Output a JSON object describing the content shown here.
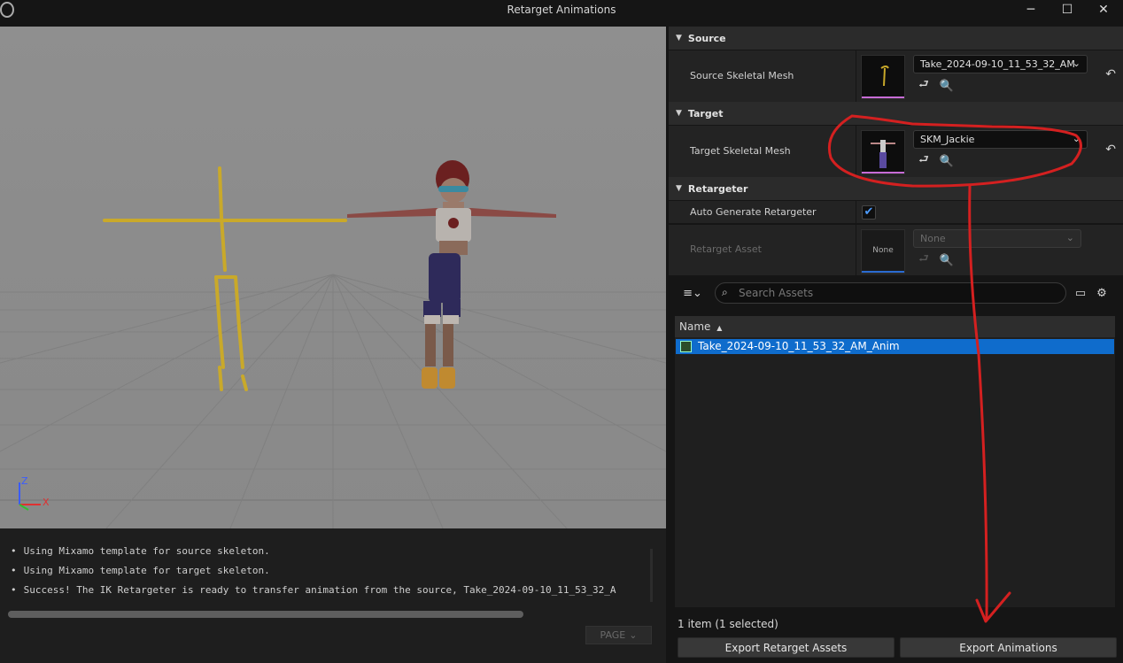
{
  "window": {
    "title": "Retarget Animations",
    "minimize": "─",
    "maximize": "☐",
    "close": "✕"
  },
  "viewport": {
    "axis_z": "Z",
    "axis_x": "X"
  },
  "log": {
    "lines": [
      "Using Mixamo template for source skeleton.",
      "Using Mixamo template for target skeleton.",
      "Success! The IK Retargeter is ready to transfer animation from the source, Take_2024-09-10_11_53_32_A"
    ],
    "page_label": "PAGE"
  },
  "details": {
    "source": {
      "header": "Source",
      "label": "Source Skeletal Mesh",
      "value": "Take_2024-09-10_11_53_32_AM"
    },
    "target": {
      "header": "Target",
      "label": "Target Skeletal Mesh",
      "value": "SKM_Jackie"
    },
    "retargeter": {
      "header": "Retargeter",
      "auto_label": "Auto Generate Retargeter",
      "auto_checked": true,
      "asset_label": "Retarget Asset",
      "asset_value": "None",
      "asset_thumb": "None"
    }
  },
  "asset_picker": {
    "search_placeholder": "Search Assets",
    "column_name": "Name",
    "sort_indicator": "▲",
    "items": [
      {
        "name": "Take_2024-09-10_11_53_32_AM_Anim",
        "selected": true
      }
    ],
    "count_text": "1 item (1 selected)"
  },
  "buttons": {
    "export_retarget": "Export Retarget Assets",
    "export_animations": "Export Animations"
  },
  "colors": {
    "selection": "#0f6ccc",
    "annotation": "#d42020",
    "accent_blue": "#4d9cff"
  }
}
